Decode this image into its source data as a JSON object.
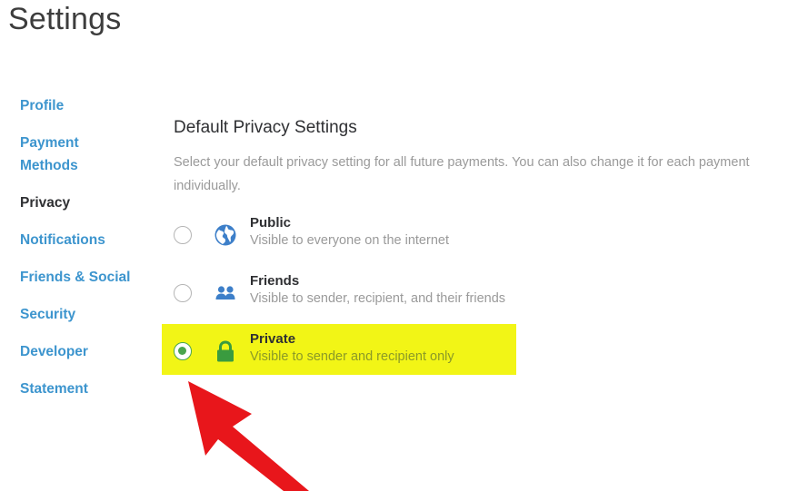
{
  "header": {
    "title": "Settings"
  },
  "sidebar": {
    "items": [
      {
        "label": "Profile"
      },
      {
        "label": "Payment\nMethods"
      },
      {
        "label": "Privacy"
      },
      {
        "label": "Notifications"
      },
      {
        "label": "Friends & Social"
      },
      {
        "label": "Security"
      },
      {
        "label": "Developer"
      },
      {
        "label": "Statement"
      }
    ],
    "active": "Privacy"
  },
  "main": {
    "title": "Default Privacy Settings",
    "description": "Select your default privacy setting for all future payments. You can also change it for each payment individually.",
    "options": [
      {
        "label": "Public",
        "description": "Visible to everyone on the internet",
        "icon": "globe-icon",
        "selected": false
      },
      {
        "label": "Friends",
        "description": "Visible to sender, recipient, and their friends",
        "icon": "friends-icon",
        "selected": false
      },
      {
        "label": "Private",
        "description": "Visible to sender and recipient only",
        "icon": "lock-icon",
        "selected": true
      }
    ]
  },
  "colors": {
    "link": "#3d95ce",
    "highlight": "#f2f516",
    "selected": "#49a54d",
    "arrow": "#e8161b"
  }
}
